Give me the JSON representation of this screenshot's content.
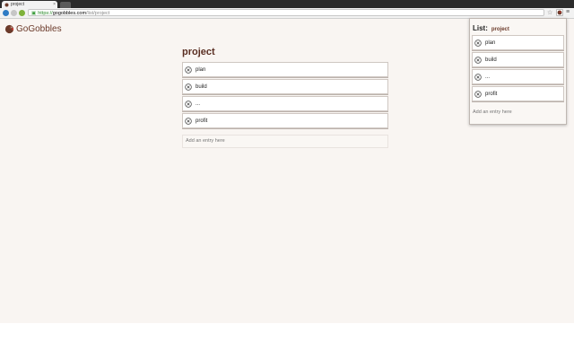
{
  "browser": {
    "tab_title": "project",
    "url_scheme": "https://",
    "url_host": "gogobbles.com",
    "url_path": "/list/project"
  },
  "app": {
    "brand": "GoGobbles",
    "brand_color": "#6b3a2a"
  },
  "main": {
    "title": "project",
    "items": [
      "plan",
      "build",
      "...",
      "profit"
    ],
    "add_placeholder": "Add an entry here"
  },
  "popup": {
    "list_label": "List:",
    "list_name": "project",
    "items": [
      "plan",
      "build",
      "...",
      "profit"
    ],
    "add_placeholder": "Add an entry here"
  },
  "icons": {
    "remove": "remove-circle-icon",
    "back": "back-icon",
    "forward": "forward-icon",
    "reload": "reload-icon",
    "star": "bookmark-star-icon",
    "menu": "menu-icon"
  }
}
